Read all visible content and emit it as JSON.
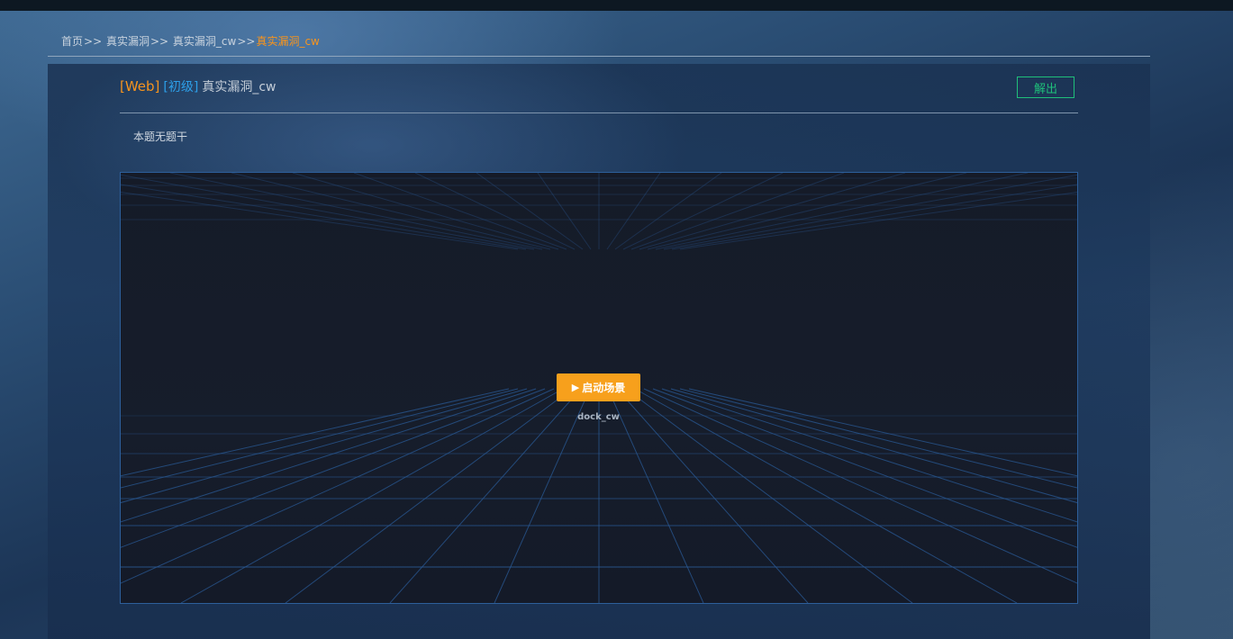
{
  "breadcrumb": {
    "items": [
      "首页",
      "真实漏洞",
      "真实漏洞_cw"
    ],
    "separator": ">>",
    "current": "真实漏洞_cw"
  },
  "challenge": {
    "category": "[Web]",
    "level": "[初级]",
    "name": "真实漏洞_cw",
    "solve_label": "解出",
    "description": "本题无题干"
  },
  "scene": {
    "start_label": "启动场景",
    "play_icon": "▶",
    "container_name": "dock_cw"
  },
  "colors": {
    "accent_orange": "#f7941d",
    "level_blue": "#2d9fe8",
    "solve_green": "#1fbf7a",
    "grid_line": "#2a5a96"
  }
}
